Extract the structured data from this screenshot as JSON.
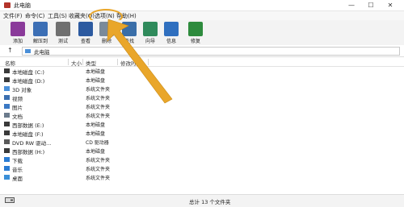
{
  "window": {
    "title": "此电脑",
    "min": "—",
    "max": "☐",
    "close": "✕"
  },
  "menu": {
    "items": [
      "文件(F)",
      "命令(C)",
      "工具(S)",
      "收藏夹(O)",
      "选项(N)",
      "帮助(H)"
    ]
  },
  "toolbar": {
    "buttons": [
      {
        "label": "添加",
        "icon": "add-archive-icon",
        "color": "#8a3a9a"
      },
      {
        "label": "解压到",
        "icon": "extract-to-icon",
        "color": "#3c6fb5"
      },
      {
        "label": "测试",
        "icon": "test-icon",
        "color": "#6f6f6f"
      },
      {
        "label": "查看",
        "icon": "view-icon",
        "color": "#2c5aa0"
      },
      {
        "label": "删除",
        "icon": "delete-icon",
        "color": "#7a8a9a"
      },
      {
        "label": "查找",
        "icon": "find-icon",
        "color": "#3a6ea8"
      },
      {
        "label": "向导",
        "icon": "wizard-icon",
        "color": "#2f8a5b"
      },
      {
        "label": "信息",
        "icon": "info-icon",
        "color": "#2f6fbf"
      },
      {
        "label": "修复",
        "icon": "repair-icon",
        "color": "#2e8b3d"
      }
    ]
  },
  "address": {
    "up": "↑",
    "path": "此电脑"
  },
  "columns": {
    "name": "名称",
    "size": "大小",
    "type": "类型",
    "modified": "修改时间"
  },
  "rows": [
    {
      "name": "本地磁盘 (C:)",
      "type": "本地磁盘",
      "icon": "drive-icon",
      "color": "#3a3a3a"
    },
    {
      "name": "本地磁盘 (D:)",
      "type": "本地磁盘",
      "icon": "drive-icon",
      "color": "#3a3a3a"
    },
    {
      "name": "3D 对象",
      "type": "系统文件夹",
      "icon": "3d-objects-icon",
      "color": "#4a90d9"
    },
    {
      "name": "视频",
      "type": "系统文件夹",
      "icon": "videos-icon",
      "color": "#3b6fb0"
    },
    {
      "name": "图片",
      "type": "系统文件夹",
      "icon": "pictures-icon",
      "color": "#3b79c4"
    },
    {
      "name": "文档",
      "type": "系统文件夹",
      "icon": "documents-icon",
      "color": "#6b7b8c"
    },
    {
      "name": "西部数据 (E:)",
      "type": "本地磁盘",
      "icon": "drive-icon",
      "color": "#3a3a3a"
    },
    {
      "name": "本地磁盘 (F:)",
      "type": "本地磁盘",
      "icon": "drive-icon",
      "color": "#3a3a3a"
    },
    {
      "name": "DVD RW 驱动...",
      "type": "CD 驱动器",
      "icon": "dvd-drive-icon",
      "color": "#5a5a5a"
    },
    {
      "name": "西部数据 (H:)",
      "type": "本地磁盘",
      "icon": "drive-icon",
      "color": "#3a3a3a"
    },
    {
      "name": "下载",
      "type": "系统文件夹",
      "icon": "downloads-icon",
      "color": "#2b7cd3"
    },
    {
      "name": "音乐",
      "type": "系统文件夹",
      "icon": "music-icon",
      "color": "#2b7cd3"
    },
    {
      "name": "桌面",
      "type": "系统文件夹",
      "icon": "desktop-icon",
      "color": "#3b8fd8"
    }
  ],
  "status": {
    "text": "总计 13 个文件夹"
  }
}
